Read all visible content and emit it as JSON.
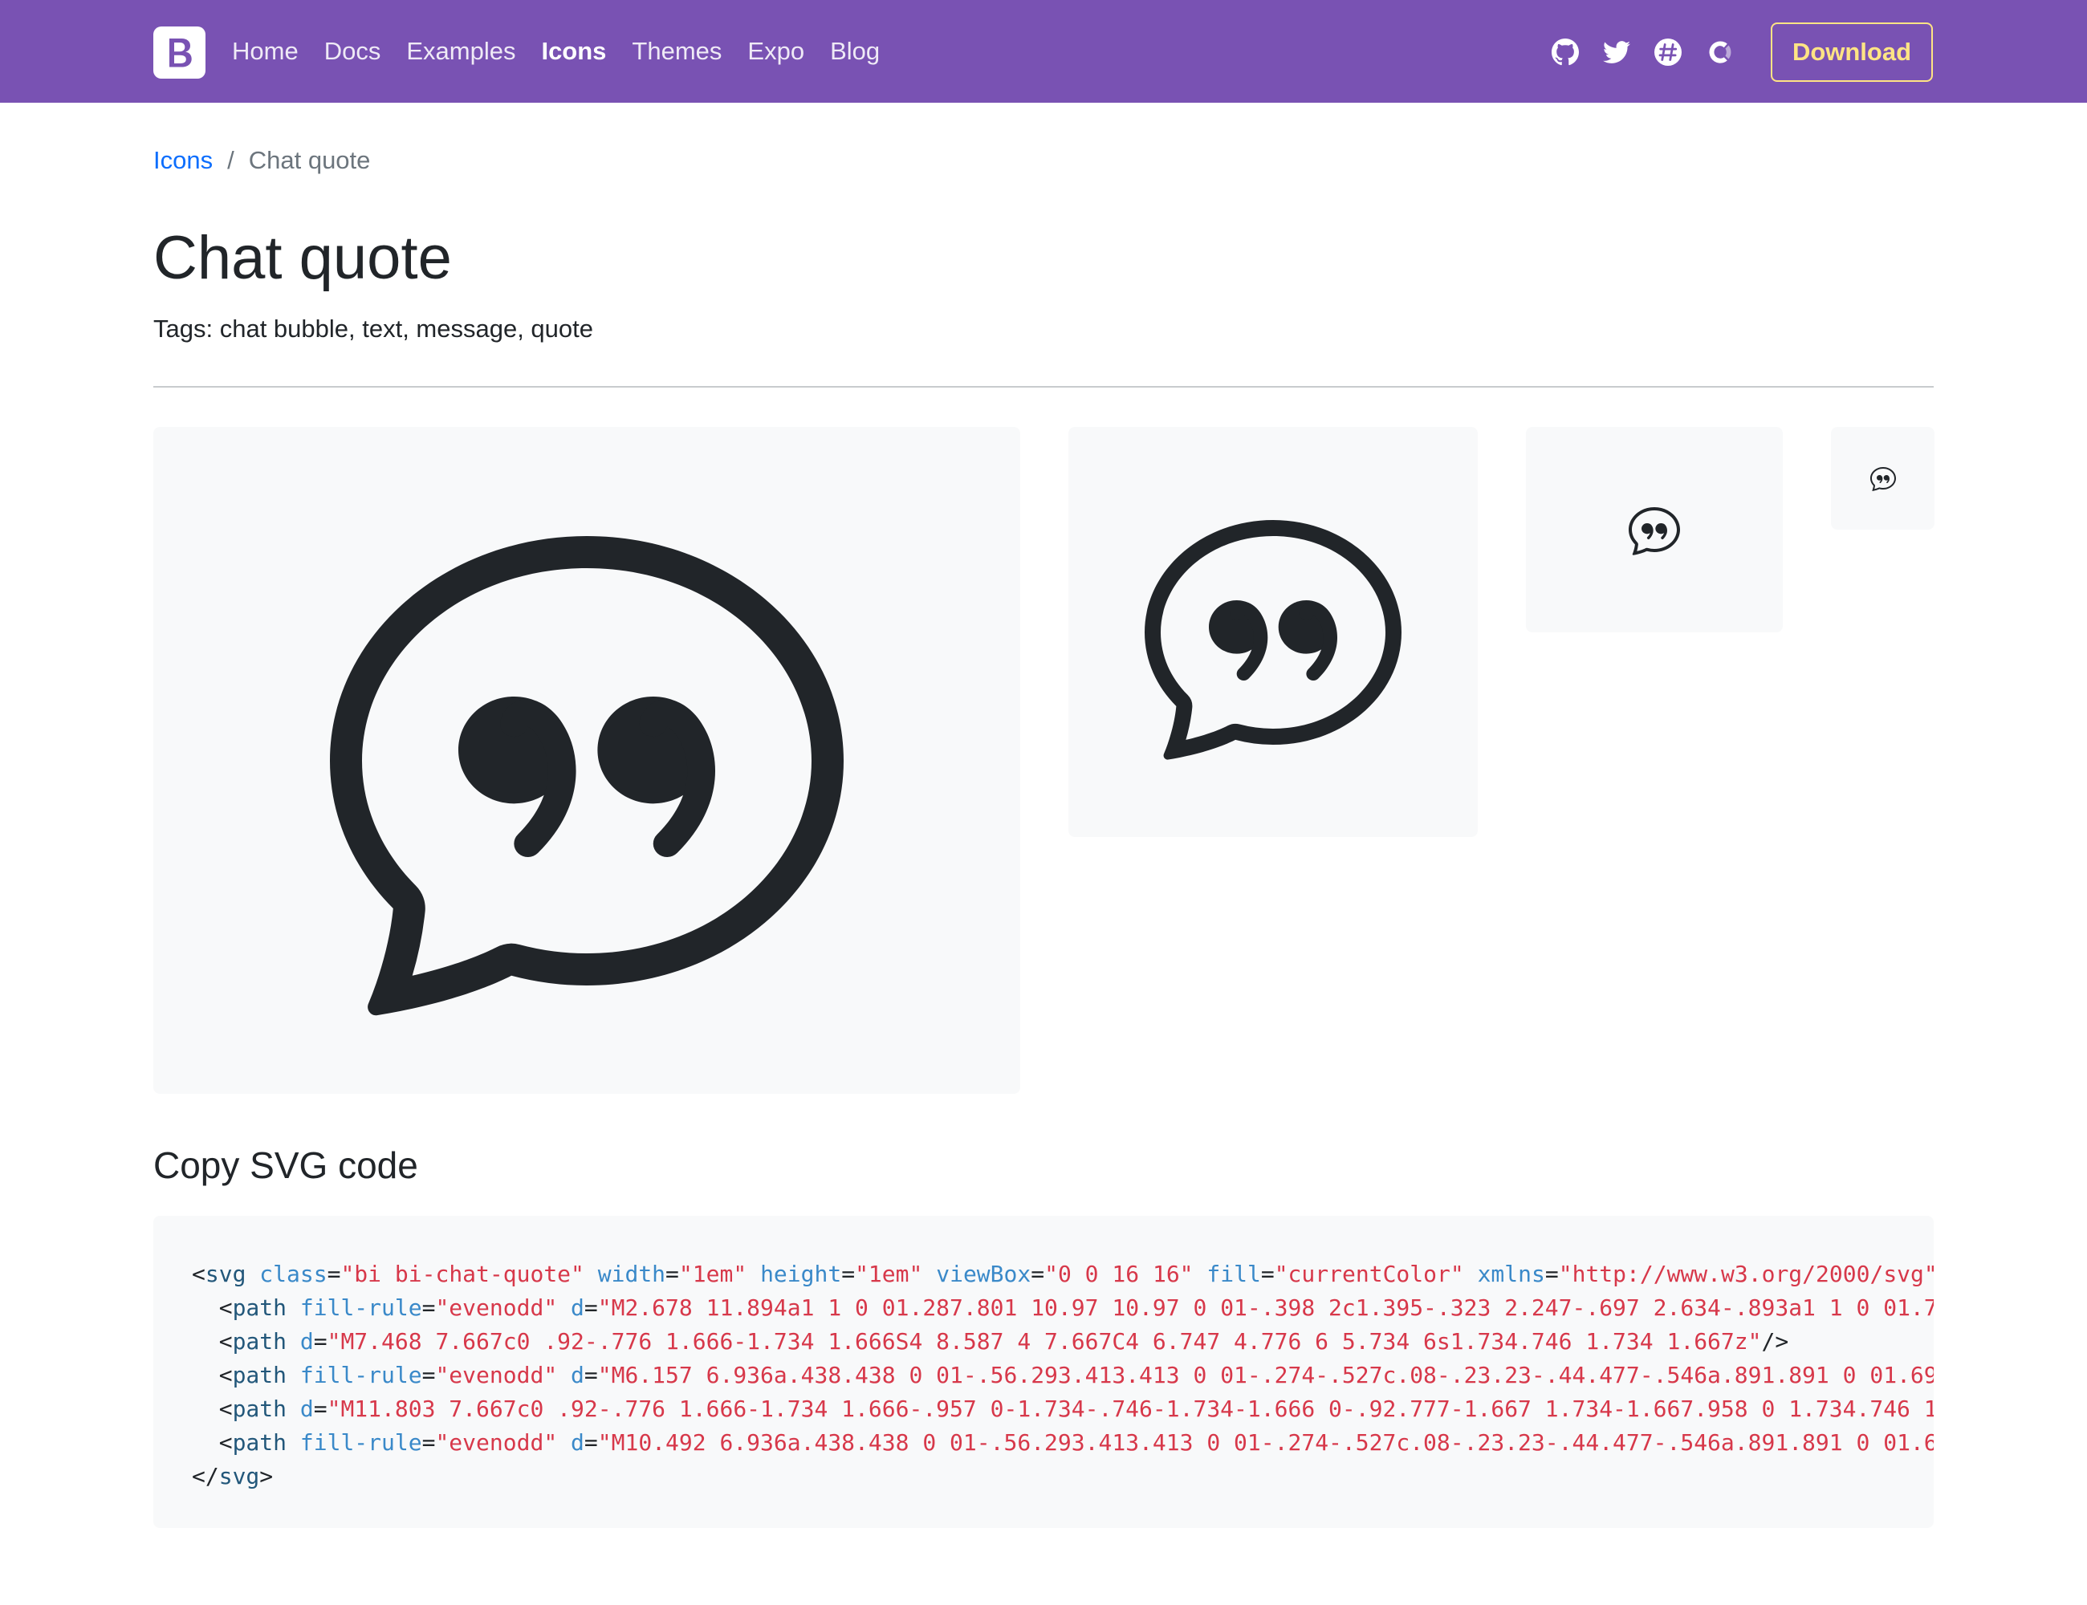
{
  "navbar": {
    "brand_letter": "B",
    "links": [
      {
        "label": "Home"
      },
      {
        "label": "Docs"
      },
      {
        "label": "Examples"
      },
      {
        "label": "Icons",
        "active": true
      },
      {
        "label": "Themes"
      },
      {
        "label": "Expo"
      },
      {
        "label": "Blog"
      }
    ],
    "social_icons": [
      "github-icon",
      "twitter-icon",
      "slack-icon",
      "opencollective-icon"
    ],
    "download_label": "Download",
    "background_color": "#7952b3",
    "download_color": "#ffe484"
  },
  "breadcrumb": {
    "parent": "Icons",
    "separator": "/",
    "current": "Chat quote"
  },
  "page": {
    "title": "Chat quote",
    "tags": "Tags: chat bubble, text, message, quote"
  },
  "previews": {
    "icon": "chat-quote-icon"
  },
  "code_section": {
    "title": "Copy SVG code",
    "lines": [
      [
        [
          "tk-punct",
          "<"
        ],
        [
          "tk-tag",
          "svg"
        ],
        [
          "tk-punct",
          " "
        ],
        [
          "tk-attr",
          "class"
        ],
        [
          "tk-punct",
          "="
        ],
        [
          "tk-val",
          "\"bi bi-chat-quote\""
        ],
        [
          "tk-punct",
          " "
        ],
        [
          "tk-attr",
          "width"
        ],
        [
          "tk-punct",
          "="
        ],
        [
          "tk-val",
          "\"1em\""
        ],
        [
          "tk-punct",
          " "
        ],
        [
          "tk-attr",
          "height"
        ],
        [
          "tk-punct",
          "="
        ],
        [
          "tk-val",
          "\"1em\""
        ],
        [
          "tk-punct",
          " "
        ],
        [
          "tk-attr",
          "viewBox"
        ],
        [
          "tk-punct",
          "="
        ],
        [
          "tk-val",
          "\"0 0 16 16\""
        ],
        [
          "tk-punct",
          " "
        ],
        [
          "tk-attr",
          "fill"
        ],
        [
          "tk-punct",
          "="
        ],
        [
          "tk-val",
          "\"currentColor\""
        ],
        [
          "tk-punct",
          " "
        ],
        [
          "tk-attr",
          "xmlns"
        ],
        [
          "tk-punct",
          "="
        ],
        [
          "tk-val",
          "\"http://www.w3.org/2000/svg\""
        ]
      ],
      [
        [
          "tk-punct",
          "  <"
        ],
        [
          "tk-tag",
          "path"
        ],
        [
          "tk-punct",
          " "
        ],
        [
          "tk-attr",
          "fill-rule"
        ],
        [
          "tk-punct",
          "="
        ],
        [
          "tk-val",
          "\"evenodd\""
        ],
        [
          "tk-punct",
          " "
        ],
        [
          "tk-attr",
          "d"
        ],
        [
          "tk-punct",
          "="
        ],
        [
          "tk-val",
          "\"M2.678 11.894a1 1 0 01.287.801 10.97 10.97 0 01-.398 2c1.395-.323 2.247-.697 2.634-.893a1 1 0 01.7"
        ]
      ],
      [
        [
          "tk-punct",
          "  <"
        ],
        [
          "tk-tag",
          "path"
        ],
        [
          "tk-punct",
          " "
        ],
        [
          "tk-attr",
          "d"
        ],
        [
          "tk-punct",
          "="
        ],
        [
          "tk-val",
          "\"M7.468 7.667c0 .92-.776 1.666-1.734 1.666S4 8.587 4 7.667C4 6.747 4.776 6 5.734 6s1.734.746 1.734 1.667z\""
        ],
        [
          "tk-punct",
          "/>"
        ]
      ],
      [
        [
          "tk-punct",
          "  <"
        ],
        [
          "tk-tag",
          "path"
        ],
        [
          "tk-punct",
          " "
        ],
        [
          "tk-attr",
          "fill-rule"
        ],
        [
          "tk-punct",
          "="
        ],
        [
          "tk-val",
          "\"evenodd\""
        ],
        [
          "tk-punct",
          " "
        ],
        [
          "tk-attr",
          "d"
        ],
        [
          "tk-punct",
          "="
        ],
        [
          "tk-val",
          "\"M6.157 6.936a.438.438 0 01-.56.293.413.413 0 01-.274-.527c.08-.23.23-.44.477-.546a.891.891 0 01.69"
        ]
      ],
      [
        [
          "tk-punct",
          "  <"
        ],
        [
          "tk-tag",
          "path"
        ],
        [
          "tk-punct",
          " "
        ],
        [
          "tk-attr",
          "d"
        ],
        [
          "tk-punct",
          "="
        ],
        [
          "tk-val",
          "\"M11.803 7.667c0 .92-.776 1.666-1.734 1.666-.957 0-1.734-.746-1.734-1.666 0-.92.777-1.667 1.734-1.667.958 0 1.734.746 1"
        ]
      ],
      [
        [
          "tk-punct",
          "  <"
        ],
        [
          "tk-tag",
          "path"
        ],
        [
          "tk-punct",
          " "
        ],
        [
          "tk-attr",
          "fill-rule"
        ],
        [
          "tk-punct",
          "="
        ],
        [
          "tk-val",
          "\"evenodd\""
        ],
        [
          "tk-punct",
          " "
        ],
        [
          "tk-attr",
          "d"
        ],
        [
          "tk-punct",
          "="
        ],
        [
          "tk-val",
          "\"M10.492 6.936a.438.438 0 01-.56.293.413.413 0 01-.274-.527c.08-.23.23-.44.477-.546a.891.891 0 01.6"
        ]
      ],
      [
        [
          "tk-punct",
          "</"
        ],
        [
          "tk-tag",
          "svg"
        ],
        [
          "tk-punct",
          ">"
        ]
      ]
    ]
  }
}
